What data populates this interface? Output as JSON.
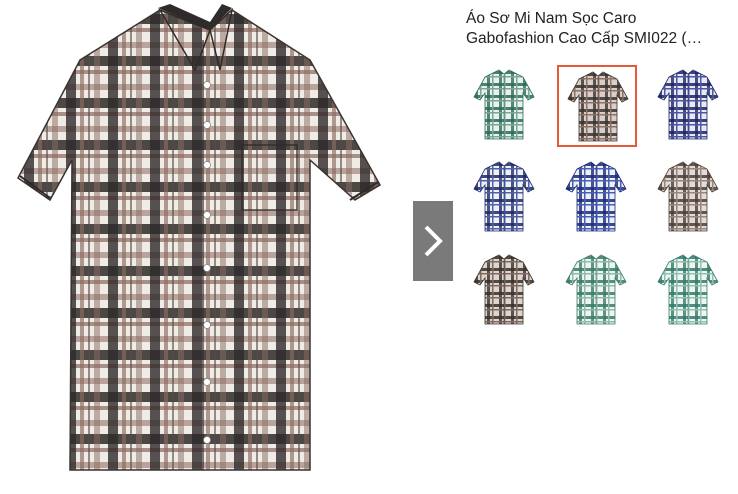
{
  "product": {
    "title_line1": "Áo Sơ Mi Nam Sọc Caro",
    "title_line2": "Gabofashion Cao Cấp SMI022 (…"
  },
  "main_image": {
    "icon": "plaid-shirt-image",
    "colors": [
      "#2f2b2a",
      "#8a6a5f",
      "#efece6"
    ]
  },
  "gallery": {
    "next_icon": "chevron-right-icon",
    "selected_index": 1,
    "thumbnails": [
      {
        "name": "thumb-green-plaid",
        "c1": "#2d6b5c",
        "c2": "#eaf1ec",
        "c3": "#79a994"
      },
      {
        "name": "thumb-brown-plaid",
        "c1": "#3b3330",
        "c2": "#d8cfc8",
        "c3": "#8d7266"
      },
      {
        "name": "thumb-navy-plaid",
        "c1": "#1c2564",
        "c2": "#e8e9f2",
        "c3": "#4b57a4"
      },
      {
        "name": "thumb-navy-white-plaid",
        "c1": "#1e2a66",
        "c2": "#f0f1f6",
        "c3": "#5061a8"
      },
      {
        "name": "thumb-blue-plaid",
        "c1": "#1a2a78",
        "c2": "#eef0f8",
        "c3": "#4a5fb6"
      },
      {
        "name": "thumb-grey-brown-plaid",
        "c1": "#4a3e3a",
        "c2": "#e2dbd6",
        "c3": "#9b867c"
      },
      {
        "name": "thumb-dark-brown-plaid",
        "c1": "#3a302c",
        "c2": "#dcd5cf",
        "c3": "#806a60"
      },
      {
        "name": "thumb-mint-plaid",
        "c1": "#3c7a6a",
        "c2": "#eef4ef",
        "c3": "#8ebca8"
      },
      {
        "name": "thumb-teal-plaid",
        "c1": "#347a6c",
        "c2": "#f0f5f2",
        "c3": "#8fc2ae"
      }
    ]
  }
}
